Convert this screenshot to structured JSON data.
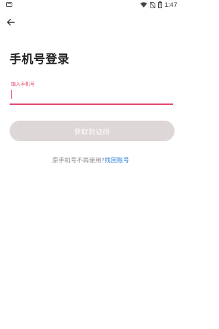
{
  "status_bar": {
    "time": "1:47",
    "icons": [
      "notification-icon",
      "wifi-icon",
      "no-sim-icon",
      "battery-icon"
    ]
  },
  "header": {
    "back_icon": "arrow-left-icon"
  },
  "main": {
    "title": "手机号登录",
    "phone_field": {
      "label": "输入手机号",
      "value": "",
      "placeholder": ""
    },
    "get_code_button": "获取验证码",
    "recover_prompt": "原手机号不再使用?",
    "recover_link": "找回账号"
  },
  "colors": {
    "accent": "#e0446a",
    "button_disabled": "#ddd7d7",
    "link": "#2b7fd8"
  }
}
